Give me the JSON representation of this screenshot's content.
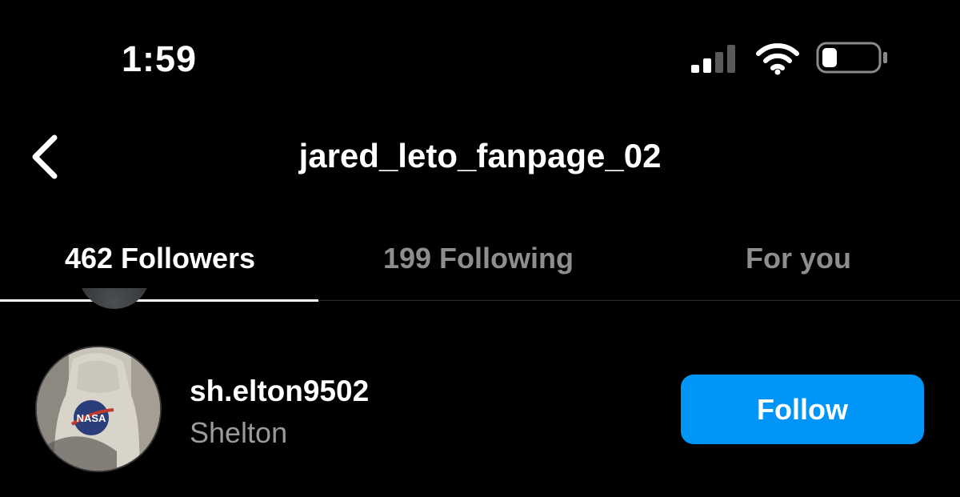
{
  "status_bar": {
    "time": "1:59",
    "signal_icon": "cellular-signal-icon",
    "wifi_icon": "wifi-icon",
    "battery_icon": "battery-icon",
    "battery_level_fraction": 0.25
  },
  "nav": {
    "back_icon": "chevron-left-icon",
    "title": "jared_leto_fanpage_02"
  },
  "tabs": [
    {
      "label": "462 Followers",
      "active": true
    },
    {
      "label": "199 Following",
      "active": false
    },
    {
      "label": "For you",
      "active": false
    }
  ],
  "list": [
    {
      "username": "sh.elton9502",
      "full_name": "Shelton",
      "action_label": "Follow",
      "avatar_text": "NASA"
    }
  ],
  "colors": {
    "background": "#000000",
    "text_primary": "#ffffff",
    "text_secondary": "#9a9a9a",
    "tab_inactive": "#8e8e8e",
    "accent": "#0095f6"
  }
}
